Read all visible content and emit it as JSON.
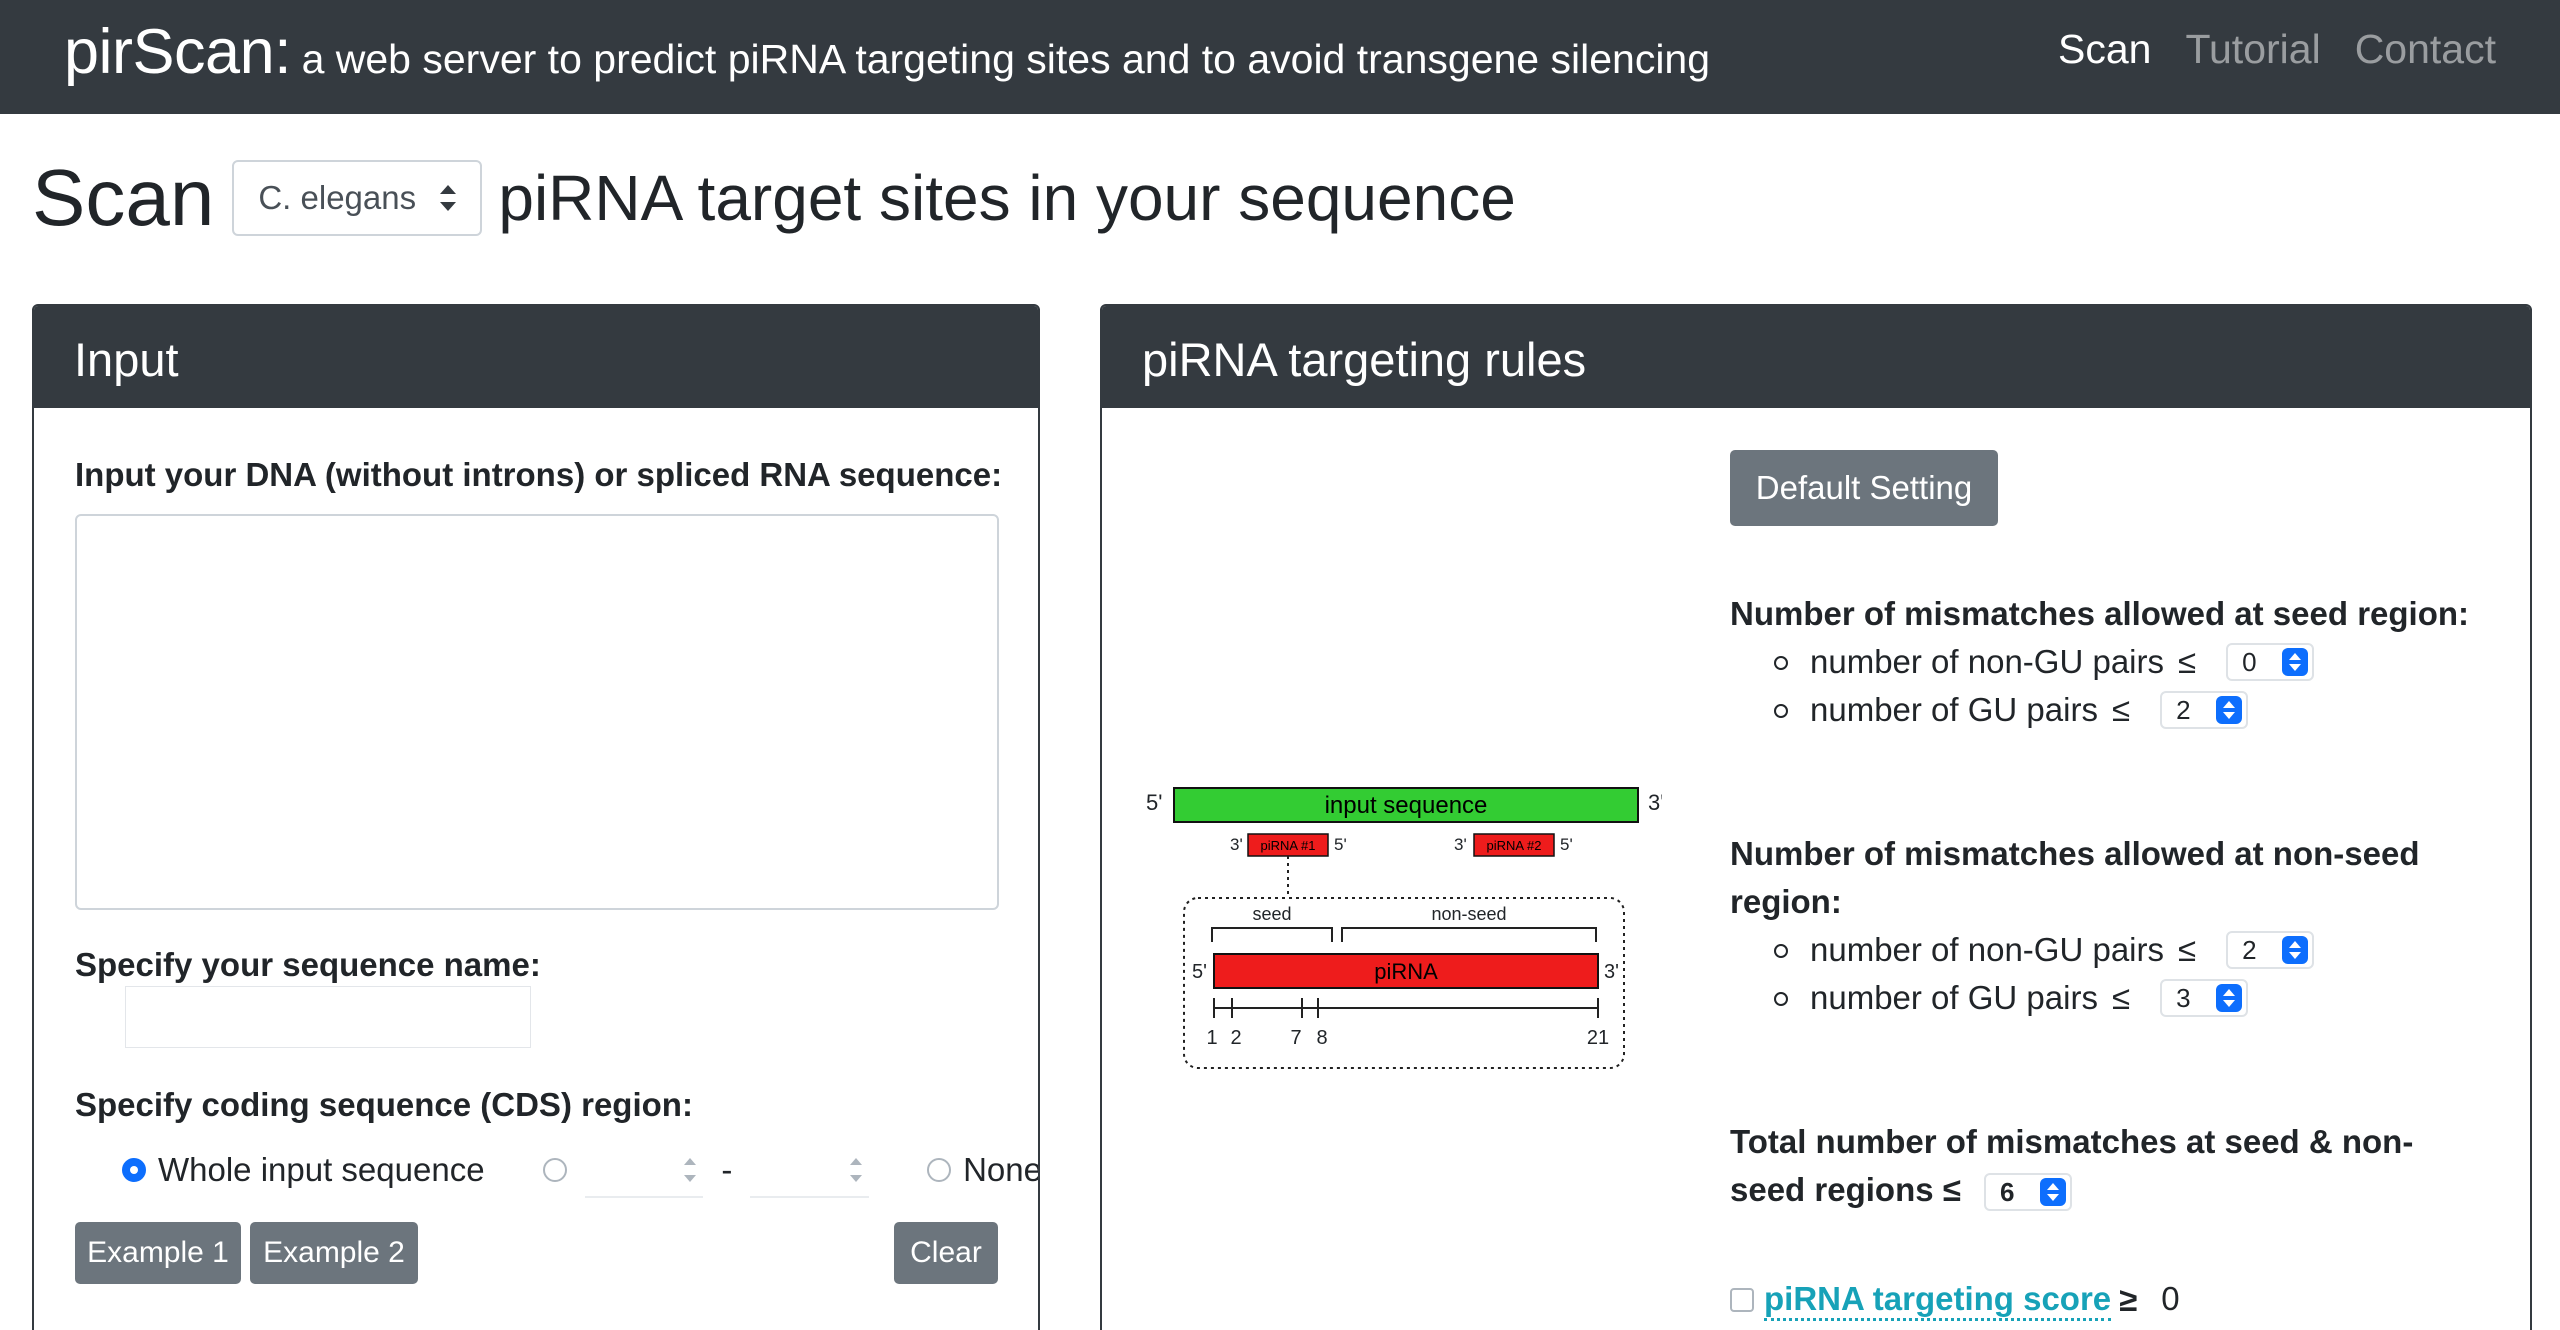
{
  "navbar": {
    "brand": "pirScan:",
    "subtitle": "a web server to predict piRNA targeting sites and to avoid transgene silencing",
    "links": [
      {
        "label": "Scan",
        "active": true
      },
      {
        "label": "Tutorial",
        "active": false
      },
      {
        "label": "Contact",
        "active": false
      }
    ]
  },
  "heading": {
    "scan": "Scan",
    "species_selected": "C. elegans",
    "rest": "piRNA target sites in your sequence"
  },
  "input_card": {
    "title": "Input",
    "sequence_label": "Input your DNA (without introns) or spliced RNA sequence:",
    "sequence_value": "",
    "name_label": "Specify your sequence name:",
    "name_value": "",
    "cds_label": "Specify coding sequence (CDS) region:",
    "cds_whole": "Whole input sequence",
    "cds_range_separator": "-",
    "cds_none": "None",
    "example1": "Example 1",
    "example2": "Example 2",
    "clear": "Clear"
  },
  "rules_card": {
    "title": "piRNA targeting rules",
    "default_button": "Default Setting",
    "seed_title": "Number of mismatches allowed at seed region:",
    "nonseed_title": "Number of mismatches allowed at non-seed region:",
    "non_gu_label": "number of non-GU pairs",
    "gu_label": "number of GU pairs",
    "le": "≤",
    "seed_non_gu": "0",
    "seed_gu": "2",
    "nonseed_non_gu": "2",
    "nonseed_gu": "3",
    "total_title": "Total number of mismatches at seed & non-seed regions ≤",
    "total_value": "6",
    "score_link": "piRNA targeting score",
    "score_ge": "≥",
    "score_value": "0"
  },
  "diagram": {
    "five_prime": "5'",
    "three_prime": "3'",
    "input_sequence": "input sequence",
    "pirna1": "piRNA #1",
    "pirna2": "piRNA #2",
    "seed": "seed",
    "non_seed": "non-seed",
    "pirna": "piRNA",
    "ticks": [
      "1",
      "2",
      "7",
      "8",
      "21"
    ]
  },
  "colors": {
    "navbar": "#343a40",
    "input_sequence_bar": "#33cc33",
    "pirna_bar": "#ee1c1c",
    "link": "#17a2b8",
    "gray_button": "#6c757d",
    "select_arrow": "#0d6efd"
  }
}
